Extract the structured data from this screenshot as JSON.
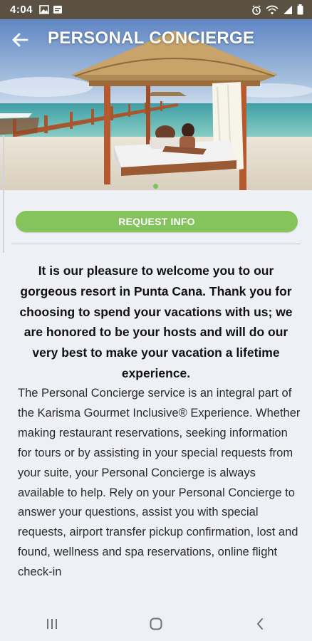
{
  "status_bar": {
    "time": "4:04",
    "left_icons": [
      "gallery-icon",
      "notification-icon"
    ],
    "right_icons": [
      "alarm-icon",
      "wifi-icon",
      "signal-icon",
      "battery-icon"
    ]
  },
  "header": {
    "title": "PERSONAL CONCIERGE",
    "back_icon": "arrow-left-icon"
  },
  "hero": {
    "description_icon": "beach-cabana-photo",
    "carousel_index": 1,
    "carousel_total": 1
  },
  "actions": {
    "request_info_label": "REQUEST INFO"
  },
  "content": {
    "intro": "It is our pleasure to welcome you to our gorgeous resort in Punta Cana. Thank you for choosing to spend your vacations with us; we are honored to be your hosts and will do our very best to make your vacation a lifetime experience.",
    "body": "The Personal Concierge service is an integral part of the Karisma Gourmet Inclusive® Experience. Whether making restaurant reservations, seeking information for tours or by assisting in your special requests from your suite, your Personal Concierge is always available to help. Rely on your Personal Concierge to answer your questions, assist you with special requests, airport transfer pickup confirmation, lost and found, wellness and spa reservations, online flight check-in"
  },
  "colors": {
    "accent": "#85c35c",
    "status_bar": "#5a5142",
    "background": "#eef0f6"
  },
  "nav_bar": {
    "buttons": [
      "recents-icon",
      "home-icon",
      "back-icon"
    ]
  }
}
